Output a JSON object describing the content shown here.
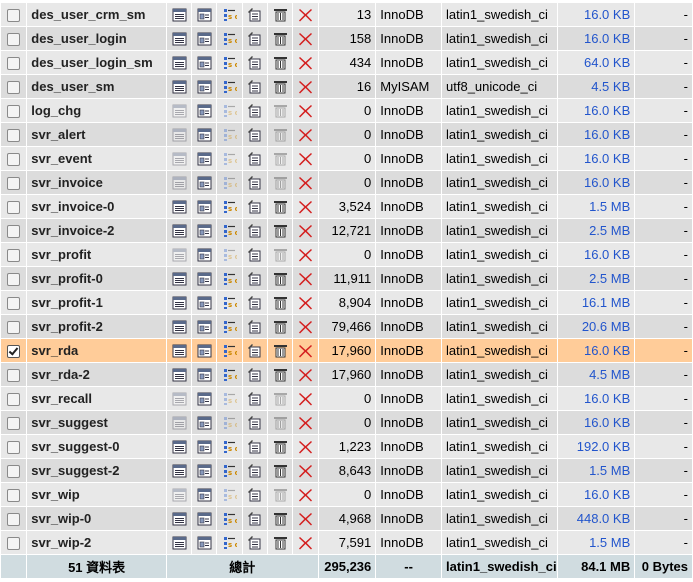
{
  "table": {
    "rows": [
      {
        "name": "des_user_crm_sm",
        "records": "13",
        "type": "InnoDB",
        "collation": "latin1_swedish_ci",
        "size": "16.0 KB",
        "overhead": "-",
        "checked": false,
        "empty": false
      },
      {
        "name": "des_user_login",
        "records": "158",
        "type": "InnoDB",
        "collation": "latin1_swedish_ci",
        "size": "16.0 KB",
        "overhead": "-",
        "checked": false,
        "empty": false
      },
      {
        "name": "des_user_login_sm",
        "records": "434",
        "type": "InnoDB",
        "collation": "latin1_swedish_ci",
        "size": "64.0 KB",
        "overhead": "-",
        "checked": false,
        "empty": false
      },
      {
        "name": "des_user_sm",
        "records": "16",
        "type": "MyISAM",
        "collation": "utf8_unicode_ci",
        "size": "4.5 KB",
        "overhead": "-",
        "checked": false,
        "empty": false
      },
      {
        "name": "log_chg",
        "records": "0",
        "type": "InnoDB",
        "collation": "latin1_swedish_ci",
        "size": "16.0 KB",
        "overhead": "-",
        "checked": false,
        "empty": true
      },
      {
        "name": "svr_alert",
        "records": "0",
        "type": "InnoDB",
        "collation": "latin1_swedish_ci",
        "size": "16.0 KB",
        "overhead": "-",
        "checked": false,
        "empty": true
      },
      {
        "name": "svr_event",
        "records": "0",
        "type": "InnoDB",
        "collation": "latin1_swedish_ci",
        "size": "16.0 KB",
        "overhead": "-",
        "checked": false,
        "empty": true
      },
      {
        "name": "svr_invoice",
        "records": "0",
        "type": "InnoDB",
        "collation": "latin1_swedish_ci",
        "size": "16.0 KB",
        "overhead": "-",
        "checked": false,
        "empty": true
      },
      {
        "name": "svr_invoice-0",
        "records": "3,524",
        "type": "InnoDB",
        "collation": "latin1_swedish_ci",
        "size": "1.5 MB",
        "overhead": "-",
        "checked": false,
        "empty": false
      },
      {
        "name": "svr_invoice-2",
        "records": "12,721",
        "type": "InnoDB",
        "collation": "latin1_swedish_ci",
        "size": "2.5 MB",
        "overhead": "-",
        "checked": false,
        "empty": false
      },
      {
        "name": "svr_profit",
        "records": "0",
        "type": "InnoDB",
        "collation": "latin1_swedish_ci",
        "size": "16.0 KB",
        "overhead": "-",
        "checked": false,
        "empty": true
      },
      {
        "name": "svr_profit-0",
        "records": "11,911",
        "type": "InnoDB",
        "collation": "latin1_swedish_ci",
        "size": "2.5 MB",
        "overhead": "-",
        "checked": false,
        "empty": false
      },
      {
        "name": "svr_profit-1",
        "records": "8,904",
        "type": "InnoDB",
        "collation": "latin1_swedish_ci",
        "size": "16.1 MB",
        "overhead": "-",
        "checked": false,
        "empty": false
      },
      {
        "name": "svr_profit-2",
        "records": "79,466",
        "type": "InnoDB",
        "collation": "latin1_swedish_ci",
        "size": "20.6 MB",
        "overhead": "-",
        "checked": false,
        "empty": false
      },
      {
        "name": "svr_rda",
        "records": "17,960",
        "type": "InnoDB",
        "collation": "latin1_swedish_ci",
        "size": "16.0 KB",
        "overhead": "-",
        "checked": true,
        "empty": false
      },
      {
        "name": "svr_rda-2",
        "records": "17,960",
        "type": "InnoDB",
        "collation": "latin1_swedish_ci",
        "size": "4.5 MB",
        "overhead": "-",
        "checked": false,
        "empty": false
      },
      {
        "name": "svr_recall",
        "records": "0",
        "type": "InnoDB",
        "collation": "latin1_swedish_ci",
        "size": "16.0 KB",
        "overhead": "-",
        "checked": false,
        "empty": true
      },
      {
        "name": "svr_suggest",
        "records": "0",
        "type": "InnoDB",
        "collation": "latin1_swedish_ci",
        "size": "16.0 KB",
        "overhead": "-",
        "checked": false,
        "empty": true
      },
      {
        "name": "svr_suggest-0",
        "records": "1,223",
        "type": "InnoDB",
        "collation": "latin1_swedish_ci",
        "size": "192.0 KB",
        "overhead": "-",
        "checked": false,
        "empty": false
      },
      {
        "name": "svr_suggest-2",
        "records": "8,643",
        "type": "InnoDB",
        "collation": "latin1_swedish_ci",
        "size": "1.5 MB",
        "overhead": "-",
        "checked": false,
        "empty": false
      },
      {
        "name": "svr_wip",
        "records": "0",
        "type": "InnoDB",
        "collation": "latin1_swedish_ci",
        "size": "16.0 KB",
        "overhead": "-",
        "checked": false,
        "empty": true
      },
      {
        "name": "svr_wip-0",
        "records": "4,968",
        "type": "InnoDB",
        "collation": "latin1_swedish_ci",
        "size": "448.0 KB",
        "overhead": "-",
        "checked": false,
        "empty": false
      },
      {
        "name": "svr_wip-2",
        "records": "7,591",
        "type": "InnoDB",
        "collation": "latin1_swedish_ci",
        "size": "1.5 MB",
        "overhead": "-",
        "checked": false,
        "empty": false
      }
    ],
    "footer": {
      "table_count": "51 資料表",
      "sum_label": "總計",
      "total_records": "295,236",
      "total_type": "--",
      "total_collation": "latin1_swedish_ci",
      "total_size": "84.1 MB",
      "total_overhead": "0 Bytes"
    }
  },
  "icons": [
    "browse-icon",
    "structure-icon",
    "search-icon",
    "insert-icon",
    "empty-icon",
    "drop-icon"
  ],
  "colors": {
    "row_odd": "#e8e8e8",
    "row_even": "#dcdcdc",
    "row_marked": "#ffcc99",
    "footer": "#d0dce0",
    "size_link": "#2255cc",
    "drop_red": "#d42020"
  }
}
